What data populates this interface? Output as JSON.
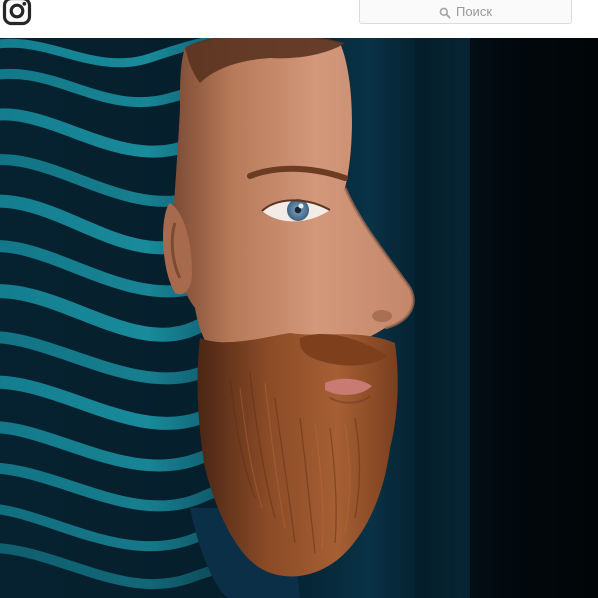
{
  "search": {
    "placeholder": "Поиск",
    "icon": "search-icon"
  },
  "header": {
    "logo_icon": "instagram-camera-icon"
  },
  "photo": {
    "icon": "illusion-portrait-photo",
    "colors": {
      "background_dark": "#02121c",
      "wave_teal": "#1fb8c9",
      "skin": "#c98b68",
      "beard": "#8a4a26",
      "eye": "#6f95b5"
    }
  }
}
